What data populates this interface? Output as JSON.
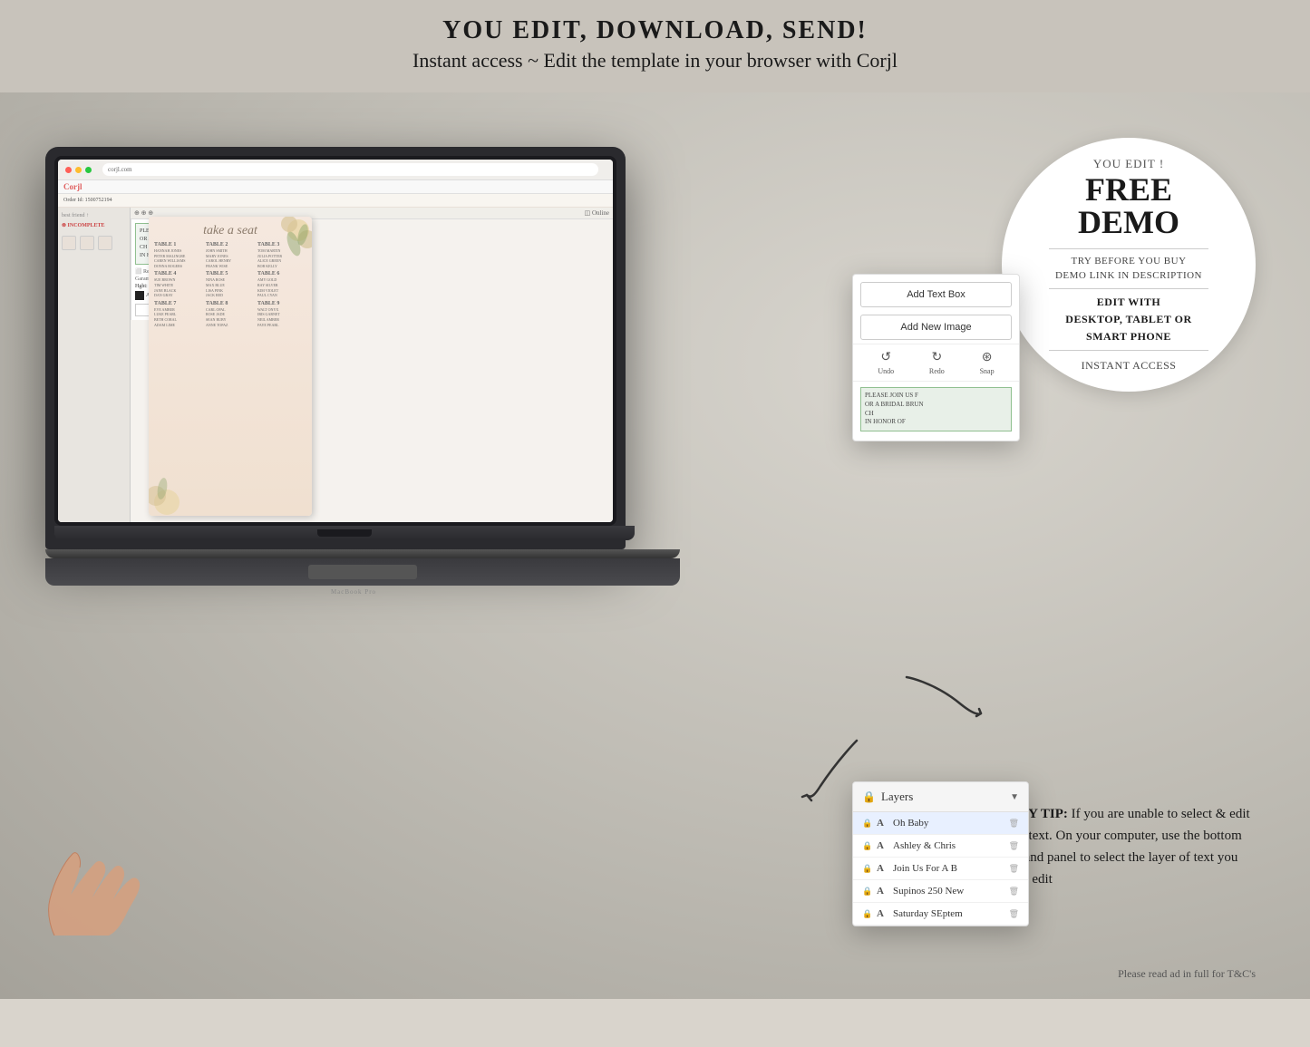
{
  "header": {
    "title": "YOU EDIT, DOWNLOAD, SEND!",
    "subtitle": "Instant access ~ Edit the template in your browser with Corjl"
  },
  "demo_circle": {
    "you_edit": "YOU EDIT !",
    "free": "FREE",
    "demo": "DEMO",
    "try_before": "TRY BEFORE YOU BUY",
    "demo_link": "DEMO LINK IN DESCRIPTION",
    "edit_with": "EDIT WITH\nDESKTOP, TABLET OR\nSMART PHONE",
    "instant_access": "INSTANT ACCESS"
  },
  "handy_tip": {
    "label": "HANDY TIP:",
    "text": " If you are unable to select & edit certain text. On your computer, use the bottom right hand panel to select the layer of text you want to edit"
  },
  "corjl_panel": {
    "add_text_box": "Add Text Box",
    "add_new_image": "Add New Image",
    "undo": "Undo",
    "redo": "Redo",
    "snap": "Snap",
    "text_preview": "PLEASE JOIN US F\nOR A BRIDAL BRUN\nCH\nIN HONOR OF"
  },
  "layers_panel": {
    "title": "Layers",
    "items": [
      {
        "name": "Oh Baby",
        "type": "A",
        "highlighted": true
      },
      {
        "name": "Ashley & Chris",
        "type": "A",
        "highlighted": false
      },
      {
        "name": "Join Us For A B",
        "type": "A",
        "highlighted": false
      },
      {
        "name": "Supinos 250 New",
        "type": "A",
        "highlighted": false
      },
      {
        "name": "Saturday SEptem",
        "type": "A",
        "highlighted": false
      }
    ]
  },
  "seating_chart": {
    "title": "take a seat",
    "tables": [
      "TABLE 1",
      "TABLE 2",
      "TABLE 3",
      "TABLE 4",
      "TABLE 5",
      "TABLE 6",
      "TABLE 7",
      "TABLE 8",
      "TABLE 9"
    ]
  },
  "browser": {
    "url": "corjl.com",
    "logo": "Corjl",
    "order_id": "Order Id: 1500752194"
  },
  "footer": {
    "text": "Please read ad in full for T&C's"
  },
  "macbook_label": "MacBook Pro"
}
